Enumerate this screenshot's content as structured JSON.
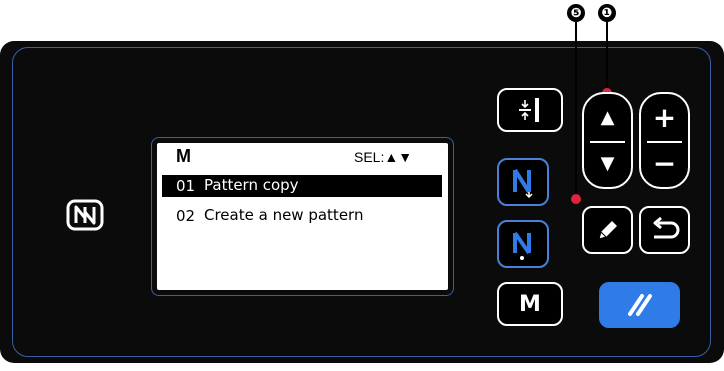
{
  "callouts": {
    "c5": "❺",
    "c1": "❶"
  },
  "lcd": {
    "title": "M",
    "sel_label": "SEL:▲▼",
    "items": [
      {
        "number": "01",
        "label": "Pattern copy",
        "selected": true
      },
      {
        "number": "02",
        "label": "Create a new pattern",
        "selected": false
      }
    ]
  },
  "buttons": {
    "m_label": "M",
    "up_glyph": "▲",
    "down_glyph": "▼",
    "plus_glyph": "+",
    "minus_glyph": "−"
  },
  "colors": {
    "panel": "#0b0b0b",
    "accent_blue": "#2f7be8",
    "frame_blue": "#3a5fa8",
    "callout_dot": "#e0243c"
  },
  "icons": [
    "nfc-icon",
    "needle-position-icon",
    "thread-trimmer-icon",
    "pedal-icon",
    "pencil-icon",
    "return-icon",
    "reset-icon"
  ]
}
